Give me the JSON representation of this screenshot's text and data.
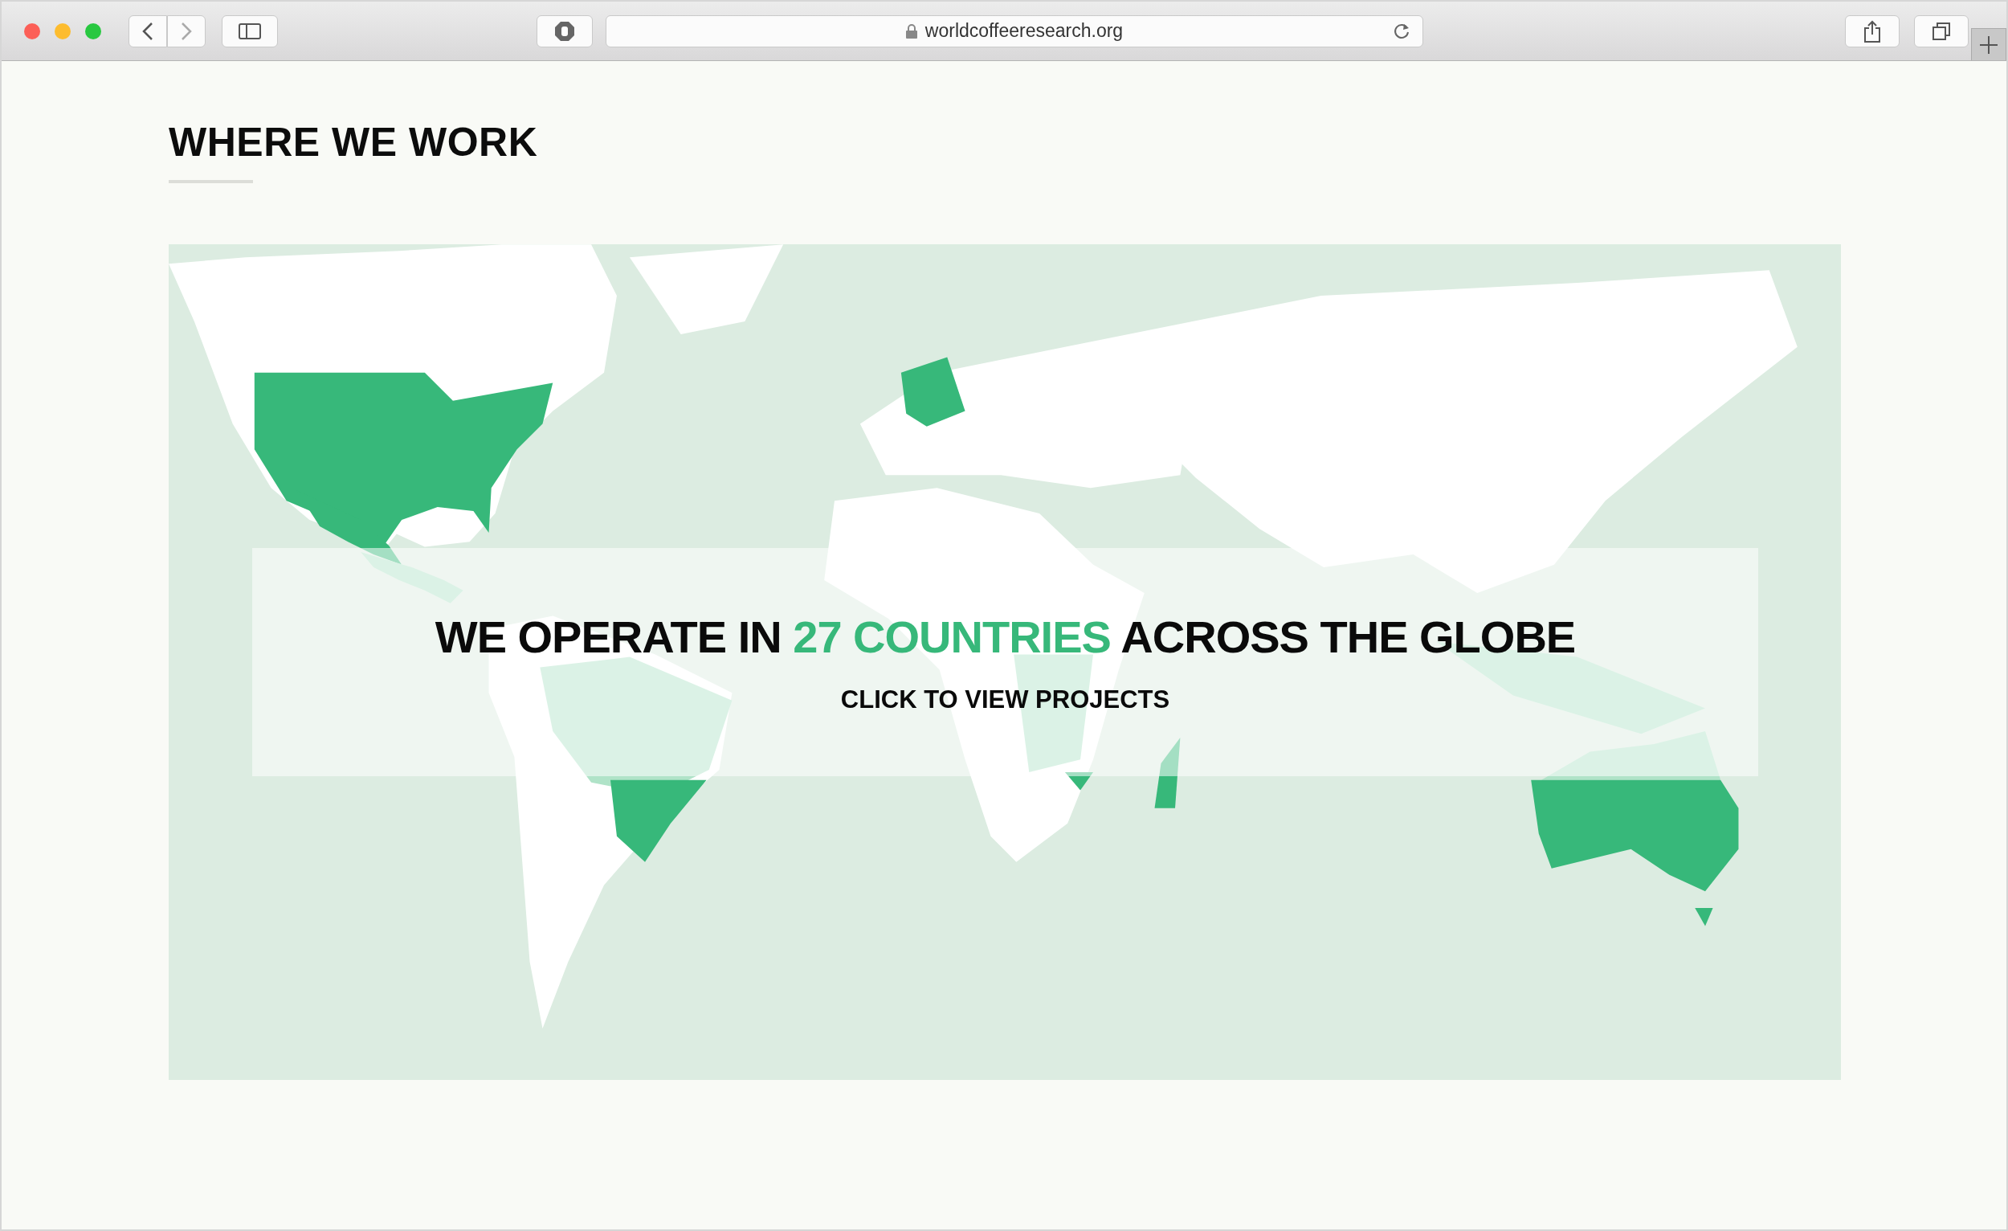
{
  "browser": {
    "url": "worldcoffeeresearch.org"
  },
  "section": {
    "title": "WHERE WE WORK"
  },
  "map_banner": {
    "headline": "WE OPERATE IN **27 COUNTRIES** ACROSS THE GLOBE",
    "link": "CLICK TO VIEW PROJECTS"
  }
}
